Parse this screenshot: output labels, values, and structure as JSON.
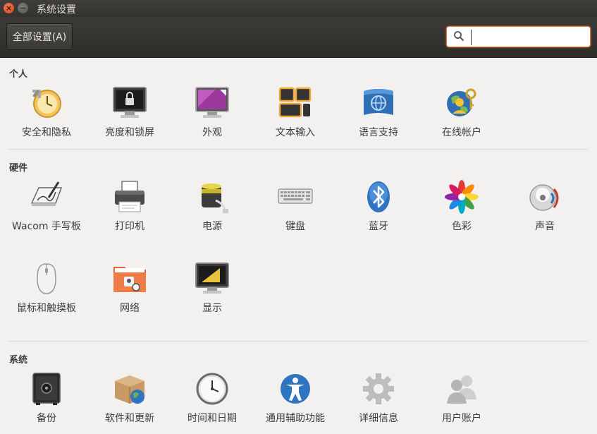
{
  "window": {
    "title": "系统设置"
  },
  "toolbar": {
    "all_settings_label": "全部设置(A)",
    "search_value": ""
  },
  "sections": {
    "personal": {
      "title": "个人",
      "items": [
        "安全和隐私",
        "亮度和锁屏",
        "外观",
        "文本输入",
        "语言支持",
        "在线帐户"
      ]
    },
    "hardware": {
      "title": "硬件",
      "items": [
        "Wacom 手写板",
        "打印机",
        "电源",
        "键盘",
        "蓝牙",
        "色彩",
        "声音",
        "鼠标和触摸板",
        "网络",
        "显示"
      ]
    },
    "system": {
      "title": "系统",
      "items": [
        "备份",
        "软件和更新",
        "时间和日期",
        "通用辅助功能",
        "详细信息",
        "用户账户"
      ]
    }
  },
  "colors": {
    "accent": "#e9752f",
    "titlebar": "#3c3b37",
    "background": "#f2f1f0"
  }
}
